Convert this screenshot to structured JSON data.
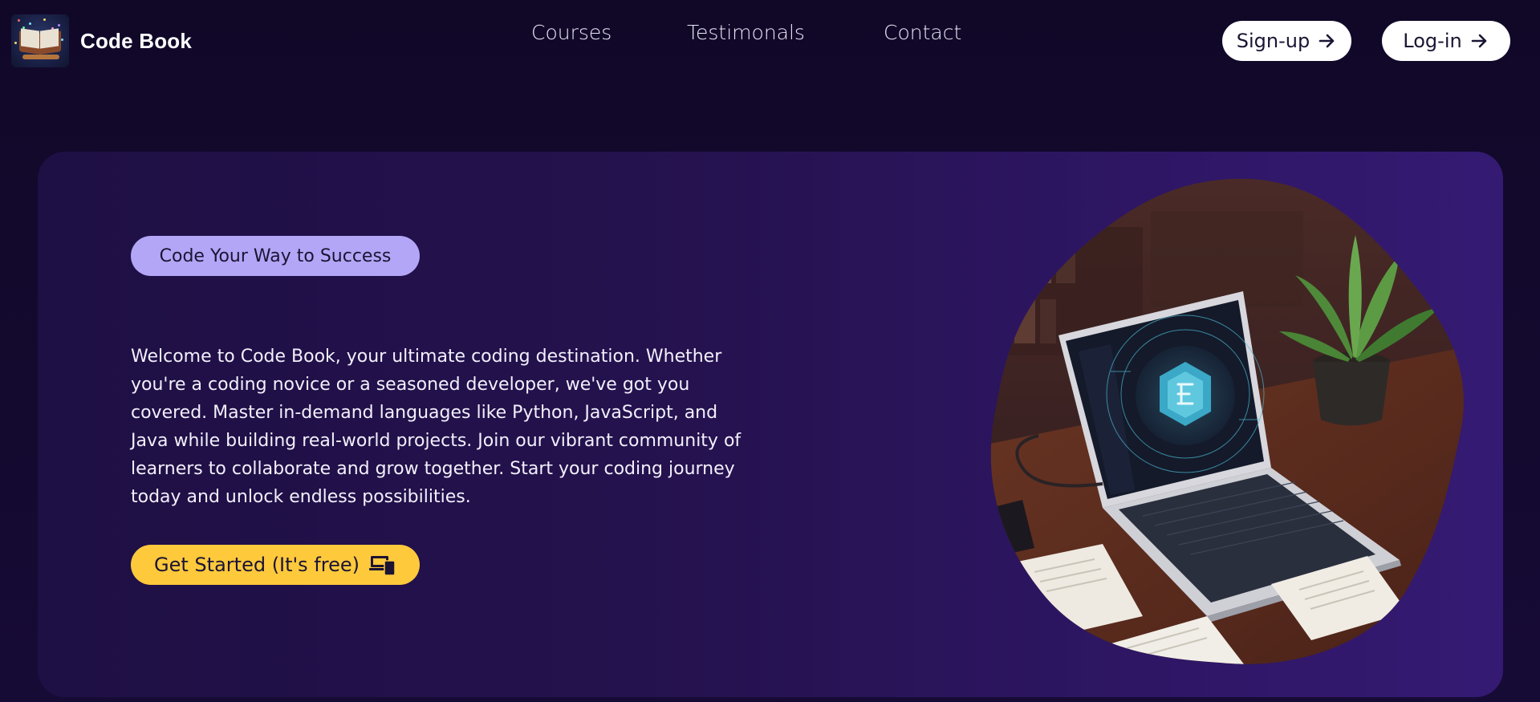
{
  "brand": {
    "name": "Code Book",
    "logo_icon": "open-book-logo-icon"
  },
  "nav": {
    "items": [
      {
        "label": "Courses"
      },
      {
        "label": "Testimonals"
      },
      {
        "label": "Contact"
      }
    ]
  },
  "auth": {
    "signup_label": "Sign-up",
    "login_label": "Log-in",
    "arrow_icon": "arrow-right-icon"
  },
  "hero": {
    "tagline": "Code Your Way to Success",
    "description": "Welcome to Code Book, your ultimate coding destination. Whether you're a coding novice or a seasoned developer, we've got you covered. Master in-demand languages like Python, JavaScript, and Java while building real-world projects. Join our vibrant community of learners to collaborate and grow together. Start your coding journey today and unlock endless possibilities.",
    "cta_label": "Get Started (It's free)",
    "cta_icon": "devices-icon",
    "image": "laptop-on-desk-illustration"
  },
  "colors": {
    "background": "#13092f",
    "hero_card": "#2a145a",
    "tagline_pill": "#b3a6f7",
    "cta_button": "#ffc93c",
    "auth_button": "#ffffff"
  }
}
